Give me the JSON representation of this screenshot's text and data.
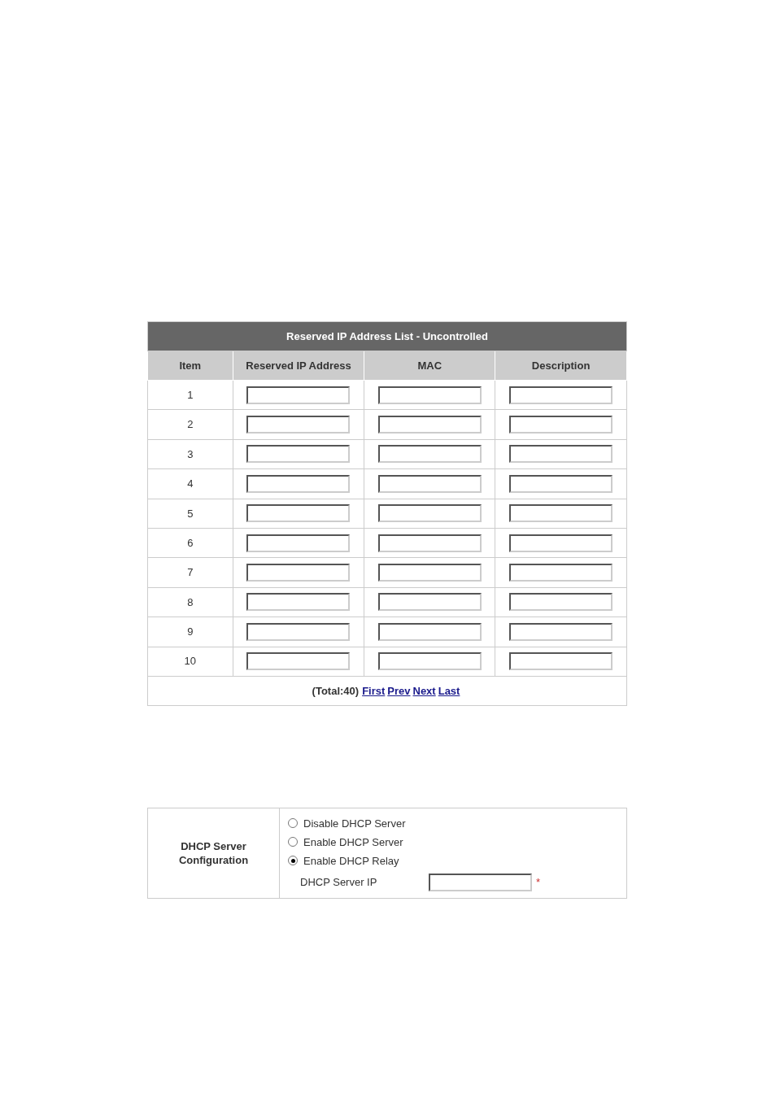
{
  "reserved_table": {
    "title": "Reserved IP Address List - Uncontrolled",
    "columns": [
      "Item",
      "Reserved IP Address",
      "MAC",
      "Description"
    ],
    "rows": [
      {
        "item": "1"
      },
      {
        "item": "2"
      },
      {
        "item": "3"
      },
      {
        "item": "4"
      },
      {
        "item": "5"
      },
      {
        "item": "6"
      },
      {
        "item": "7"
      },
      {
        "item": "8"
      },
      {
        "item": "9"
      },
      {
        "item": "10"
      }
    ],
    "total": "(Total:40)",
    "pager_links": [
      "First",
      "Prev",
      "Next",
      "Last"
    ]
  },
  "dhcp": {
    "label": "DHCP Server Configuration",
    "options": [
      {
        "label": "Disable DHCP Server",
        "selected": false
      },
      {
        "label": "Enable DHCP Server",
        "selected": false
      },
      {
        "label": "Enable DHCP Relay",
        "selected": true
      }
    ],
    "server_ip_label": "DHCP Server IP",
    "required_mark": "*"
  }
}
